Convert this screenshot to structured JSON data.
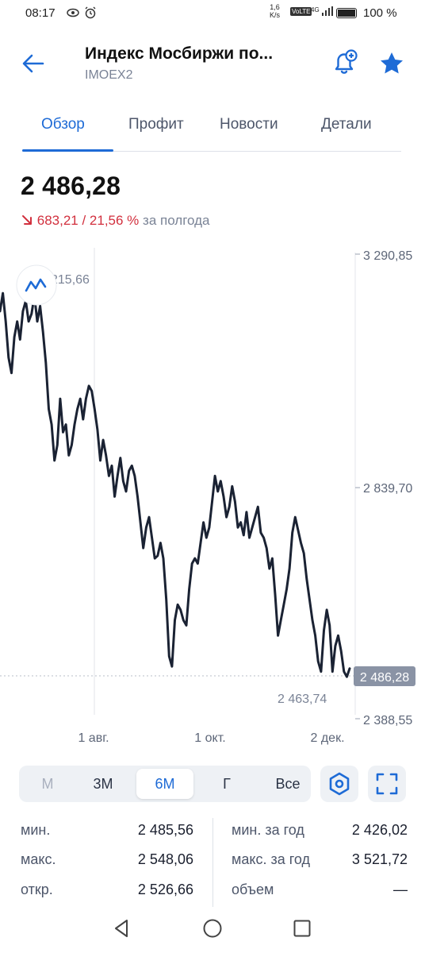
{
  "status_bar": {
    "time": "08:17",
    "net_speed_value": "1,6",
    "net_speed_unit": "K/s",
    "volte": "VoLTE",
    "signal": "4G",
    "battery": "100 %"
  },
  "header": {
    "title": "Индекс Мосбиржи по...",
    "ticker": "IMOEX2",
    "back_icon": "arrow-left-icon",
    "alert_icon": "bell-plus-icon",
    "favorite_icon": "star-icon",
    "accent_color": "#1e6bd6"
  },
  "tabs": [
    {
      "label": "Обзор",
      "active": true
    },
    {
      "label": "Профит",
      "active": false
    },
    {
      "label": "Новости",
      "active": false
    },
    {
      "label": "Детали",
      "active": false
    }
  ],
  "quote": {
    "price": "2 486,28",
    "change_abs": "683,21",
    "change_sep": " / ",
    "change_pct": "21,56 %",
    "period": "за полгода",
    "down_color": "#d2303e"
  },
  "chart_data": {
    "type": "line",
    "y_ticks": [
      "3 290,85",
      "2 839,70",
      "2 388,55"
    ],
    "ylim": [
      2388.55,
      3290.85
    ],
    "x_ticks": [
      "1 авг.",
      "1 окт.",
      "2 дек."
    ],
    "max_label": "3 215,66",
    "max_label_visible": "215,66",
    "min_label": "2 463,74",
    "last_label": "2 486,28",
    "series": [
      {
        "values": [
          3180,
          3215,
          3160,
          3090,
          3060,
          3130,
          3160,
          3125,
          3180,
          3200,
          3160,
          3175,
          3210,
          3160,
          3190,
          3140,
          3080,
          2990,
          2960,
          2890,
          2920,
          3010,
          2945,
          2960,
          2900,
          2920,
          2960,
          2990,
          3010,
          2970,
          3010,
          3035,
          3025,
          2990,
          2950,
          2890,
          2930,
          2900,
          2860,
          2880,
          2820,
          2860,
          2895,
          2850,
          2830,
          2870,
          2880,
          2860,
          2820,
          2770,
          2720,
          2760,
          2780,
          2740,
          2700,
          2705,
          2730,
          2700,
          2620,
          2510,
          2490,
          2580,
          2610,
          2600,
          2580,
          2570,
          2640,
          2690,
          2700,
          2690,
          2730,
          2770,
          2740,
          2760,
          2810,
          2860,
          2830,
          2850,
          2820,
          2780,
          2800,
          2840,
          2810,
          2760,
          2770,
          2745,
          2790,
          2740,
          2760,
          2780,
          2800,
          2750,
          2740,
          2720,
          2680,
          2700,
          2630,
          2550,
          2580,
          2610,
          2640,
          2680,
          2750,
          2780,
          2755,
          2730,
          2710,
          2660,
          2620,
          2580,
          2550,
          2500,
          2480,
          2560,
          2600,
          2570,
          2480,
          2530,
          2550,
          2520,
          2480,
          2470,
          2486
        ]
      }
    ],
    "line_color": "#1a2233",
    "grid": false
  },
  "chart_mode_icon": "line-chart-icon",
  "periods": [
    {
      "label": "М",
      "state": "disabled"
    },
    {
      "label": "3М",
      "state": "normal"
    },
    {
      "label": "6М",
      "state": "active"
    },
    {
      "label": "Г",
      "state": "normal"
    },
    {
      "label": "Все",
      "state": "normal"
    }
  ],
  "tools": {
    "settings_icon": "hexagon-settings-icon",
    "fullscreen_icon": "fullscreen-icon"
  },
  "stats": {
    "left": [
      {
        "label": "мин.",
        "value": "2 485,56"
      },
      {
        "label": "макс.",
        "value": "2 548,06"
      },
      {
        "label": "откр.",
        "value": "2 526,66"
      }
    ],
    "right": [
      {
        "label": "мин. за год",
        "value": "2 426,02"
      },
      {
        "label": "макс. за год",
        "value": "3 521,72"
      },
      {
        "label": "объем",
        "value": "—"
      }
    ]
  },
  "nav": {
    "back_icon": "triangle-back-icon",
    "home_icon": "circle-home-icon",
    "recents_icon": "square-recents-icon"
  }
}
